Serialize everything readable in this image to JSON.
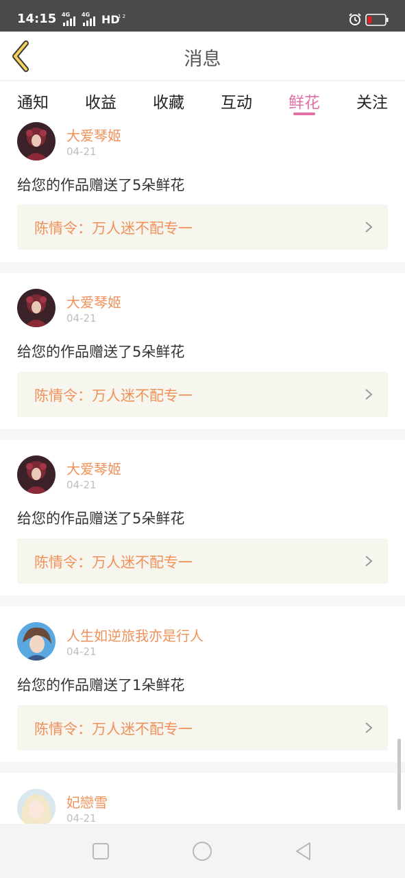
{
  "status_bar": {
    "time": "14:15",
    "network_1": "4G",
    "network_2": "4G",
    "hd_label": "HD",
    "hd_sub": "1 2"
  },
  "header": {
    "title": "消息",
    "back_icon": "chevron-left-icon"
  },
  "tabs": [
    {
      "label": "通知",
      "active": false
    },
    {
      "label": "收益",
      "active": false
    },
    {
      "label": "收藏",
      "active": false
    },
    {
      "label": "互动",
      "active": false
    },
    {
      "label": "鲜花",
      "active": true
    },
    {
      "label": "关注",
      "active": false
    }
  ],
  "colors": {
    "accent": "#e46fa6",
    "username": "#f0915a",
    "work_bg": "#f6f5ee",
    "date": "#bdbdbd"
  },
  "feed": [
    {
      "user": "大爱琴姬",
      "date": "04-21",
      "message": "给您的作品赠送了5朵鲜花",
      "work": "陈情令：万人迷不配专一"
    },
    {
      "user": "大爱琴姬",
      "date": "04-21",
      "message": "给您的作品赠送了5朵鲜花",
      "work": "陈情令：万人迷不配专一"
    },
    {
      "user": "大爱琴姬",
      "date": "04-21",
      "message": "给您的作品赠送了5朵鲜花",
      "work": "陈情令：万人迷不配专一"
    },
    {
      "user": "人生如逆旅我亦是行人",
      "date": "04-21",
      "message": "给您的作品赠送了1朵鲜花",
      "work": "陈情令：万人迷不配专一"
    },
    {
      "user": "妃戀雪",
      "date": "04-21"
    }
  ],
  "nav_bar": {
    "icons": [
      "square-icon",
      "circle-icon",
      "triangle-back-icon"
    ]
  }
}
